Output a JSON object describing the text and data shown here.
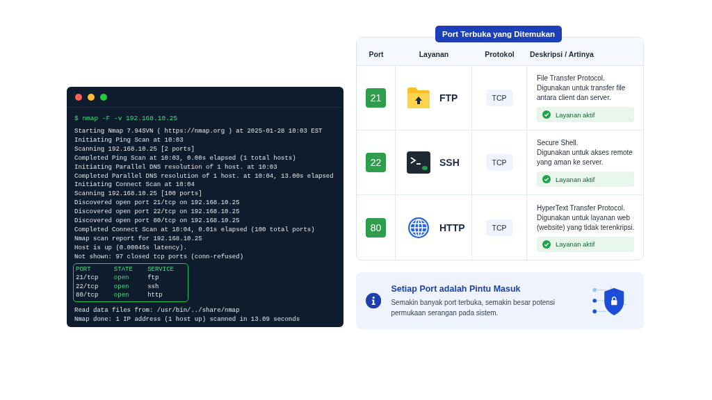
{
  "terminal": {
    "command": "$ nmap -F -v 192.168.10.25",
    "output": [
      "Starting Nmap 7.94SVN ( https://nmap.org ) at 2025-01-28 10:03 EST",
      "Initiating Ping Scan at 10:03",
      "Scanning 192.168.10.25 [2 ports]",
      "Completed Ping Scan at 10:03, 0.00s elapsed (1 total hosts)",
      "Initiating Parallel DNS resolution of 1 host. at 10:03",
      "Completed Parallel DNS resolution of 1 host. at 10:04, 13.00s elapsed",
      "Initiating Connect Scan at 10:04",
      "Scanning 192.168.10.25 [100 ports]",
      "Discovered open port 21/tcp on 192.168.10.25",
      "Discovered open port 22/tcp on 192.168.10.25",
      "Discovered open port 80/tcp on 192.168.10.25",
      "Completed Connect Scan at 10:04, 0.01s elapsed (100 total ports)",
      "Nmap scan report for 192.168.10.25",
      "Host is up (0.00045s latency).",
      "Not shown: 97 closed tcp ports (conn-refused)"
    ],
    "port_table": {
      "columns": [
        "PORT",
        "STATE",
        "SERVICE"
      ],
      "rows": [
        [
          "21/tcp",
          "open",
          "ftp"
        ],
        [
          "22/tcp",
          "open",
          "ssh"
        ],
        [
          "80/tcp",
          "open",
          "http"
        ]
      ]
    },
    "footer": [
      "Read data files from: /usr/bin/../share/nmap",
      "Nmap done: 1 IP address (1 host up) scanned in 13.09 seconds"
    ]
  },
  "panel": {
    "title": "Port Terbuka yang Ditemukan",
    "columns": [
      "Port",
      "Layanan",
      "Protokol",
      "Deskripsi / Artinya"
    ],
    "rows": [
      {
        "port": "21",
        "service": "FTP",
        "protocol": "TCP",
        "description": [
          "File Transfer Protocol.",
          "Digunakan untuk transfer file antara client dan server."
        ],
        "status": "Layanan aktif"
      },
      {
        "port": "22",
        "service": "SSH",
        "protocol": "TCP",
        "description": [
          "Secure Shell.",
          "Digunakan untuk akses remote yang aman ke server."
        ],
        "status": "Layanan aktif"
      },
      {
        "port": "80",
        "service": "HTTP",
        "protocol": "TCP",
        "description": [
          "HyperText Transfer Protocol.",
          "Digunakan untuk layanan web (website) yang tidak terenkripsi."
        ],
        "status": "Layanan aktif"
      }
    ]
  },
  "info": {
    "title": "Setiap Port adalah Pintu Masuk",
    "text": "Semakin banyak port terbuka, semakin besar potensi permukaan serangan pada sistem."
  }
}
